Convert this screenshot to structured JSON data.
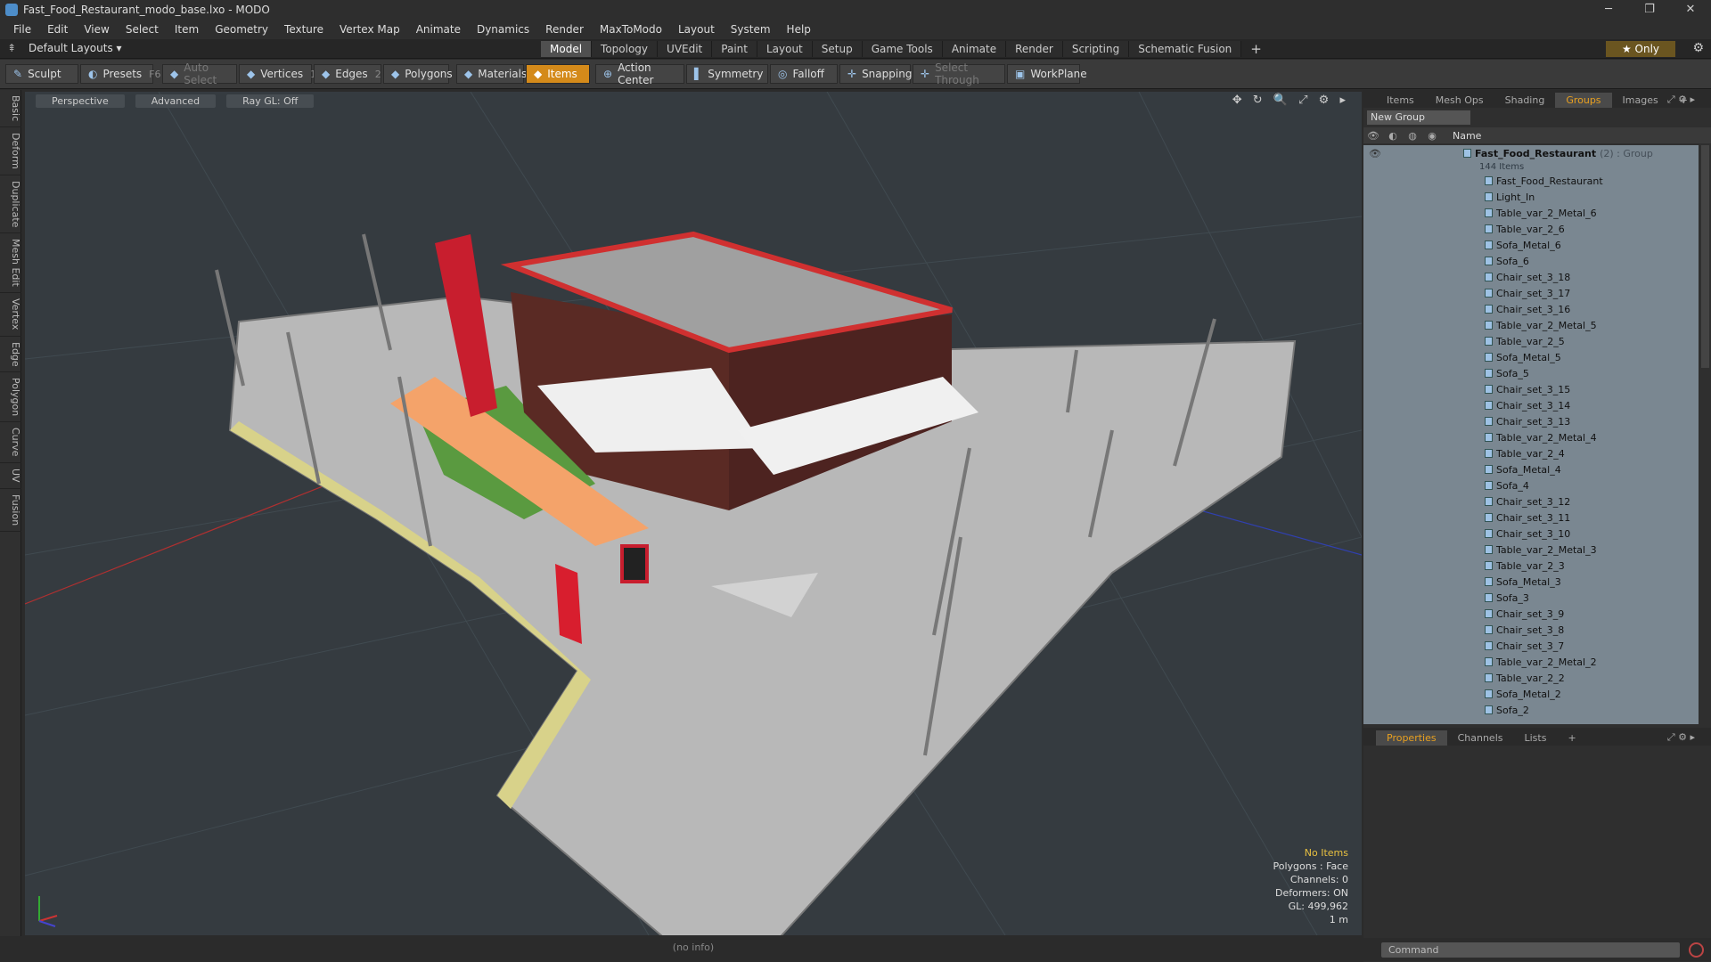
{
  "window": {
    "title": "Fast_Food_Restaurant_modo_base.lxo - MODO",
    "minimize": "─",
    "restore": "❐",
    "close": "✕"
  },
  "menu": [
    "File",
    "Edit",
    "View",
    "Select",
    "Item",
    "Geometry",
    "Texture",
    "Vertex Map",
    "Animate",
    "Dynamics",
    "Render",
    "MaxToModo",
    "Layout",
    "System",
    "Help"
  ],
  "layout_selector": "Default Layouts ▾",
  "layout_tabs": [
    "Model",
    "Topology",
    "UVEdit",
    "Paint",
    "Layout",
    "Setup",
    "Game Tools",
    "Animate",
    "Render",
    "Scripting",
    "Schematic Fusion"
  ],
  "layout_tabs_active": "Model",
  "only_label": "★  Only",
  "toolbar": {
    "sculpt": "Sculpt",
    "presets": "Presets",
    "presets_key": "F6",
    "auto_select": "Auto Select",
    "vertices": "Vertices",
    "vertices_key": "1",
    "edges": "Edges",
    "edges_key": "2",
    "polygons": "Polygons",
    "materials": "Materials",
    "items": "Items",
    "action_center": "Action Center",
    "symmetry": "Symmetry",
    "falloff": "Falloff",
    "snapping": "Snapping",
    "select_through": "Select Through",
    "workplane": "WorkPlane"
  },
  "left_tabs": [
    "Basic",
    "Deform",
    "Duplicate",
    "Mesh Edit",
    "Vertex",
    "Edge",
    "Polygon",
    "Curve",
    "UV",
    "Fusion"
  ],
  "viewport": {
    "view_mode": "Perspective",
    "advanced": "Advanced",
    "raygl": "Ray GL: Off",
    "nav_icons": "✥ ↻ 🔍 ⤢ ⚙ ▸"
  },
  "stats": {
    "no_items": "No Items",
    "polygons": "Polygons : Face",
    "channels": "Channels: 0",
    "deformers": "Deformers: ON",
    "gl": "GL: 499,962",
    "scale": "1 m"
  },
  "status": "(no info)",
  "panel_tabs": [
    "Items",
    "Mesh Ops",
    "Shading",
    "Groups",
    "Images",
    "+"
  ],
  "panel_tabs_active": "Groups",
  "new_group": "New Group",
  "tree_header": "Name",
  "group": {
    "name": "Fast_Food_Restaurant",
    "meta": "(2) : Group",
    "count": "144 Items"
  },
  "tree_items": [
    "Fast_Food_Restaurant",
    "Light_In",
    "Table_var_2_Metal_6",
    "Table_var_2_6",
    "Sofa_Metal_6",
    "Sofa_6",
    "Chair_set_3_18",
    "Chair_set_3_17",
    "Chair_set_3_16",
    "Table_var_2_Metal_5",
    "Table_var_2_5",
    "Sofa_Metal_5",
    "Sofa_5",
    "Chair_set_3_15",
    "Chair_set_3_14",
    "Chair_set_3_13",
    "Table_var_2_Metal_4",
    "Table_var_2_4",
    "Sofa_Metal_4",
    "Sofa_4",
    "Chair_set_3_12",
    "Chair_set_3_11",
    "Chair_set_3_10",
    "Table_var_2_Metal_3",
    "Table_var_2_3",
    "Sofa_Metal_3",
    "Sofa_3",
    "Chair_set_3_9",
    "Chair_set_3_8",
    "Chair_set_3_7",
    "Table_var_2_Metal_2",
    "Table_var_2_2",
    "Sofa_Metal_2",
    "Sofa_2"
  ],
  "props_tabs": [
    "Properties",
    "Channels",
    "Lists",
    "+"
  ],
  "props_tabs_active": "Properties",
  "command_placeholder": "Command",
  "colors": {
    "accent": "#e8a020",
    "items_active": "#d48a1a",
    "tree_bg": "#7a8791",
    "viewport_bg": "#353b40"
  }
}
